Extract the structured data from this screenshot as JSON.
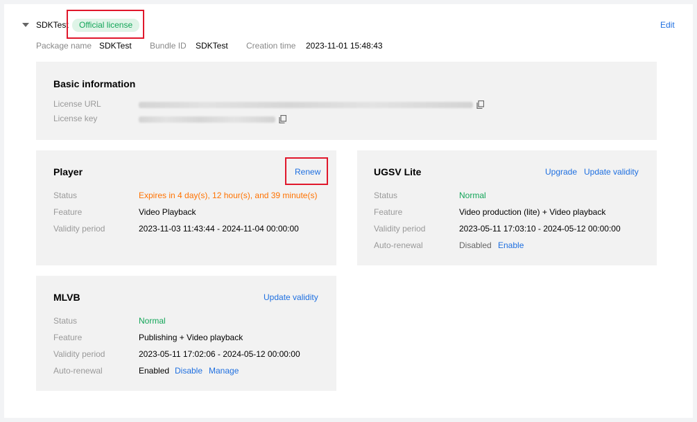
{
  "header": {
    "app_name": "SDKTest",
    "license_tag": "Official license",
    "edit_label": "Edit",
    "meta": [
      {
        "label": "Package name",
        "value": "SDKTest"
      },
      {
        "label": "Bundle ID",
        "value": "SDKTest"
      },
      {
        "label": "Creation time",
        "value": "2023-11-01 15:48:43"
      }
    ]
  },
  "basic": {
    "title": "Basic information",
    "license_url_label": "License URL",
    "license_key_label": "License key"
  },
  "player": {
    "title": "Player",
    "renew_label": "Renew",
    "rows": [
      {
        "label": "Status",
        "value": "Expires in 4 day(s), 12 hour(s), and 39 minute(s)"
      },
      {
        "label": "Feature",
        "value": "Video Playback"
      },
      {
        "label": "Validity period",
        "value": "2023-11-03 11:43:44 - 2024-11-04 00:00:00"
      }
    ]
  },
  "ugsv": {
    "title": "UGSV Lite",
    "upgrade_label": "Upgrade",
    "update_label": "Update validity",
    "rows": [
      {
        "label": "Status",
        "value": "Normal"
      },
      {
        "label": "Feature",
        "value": "Video production (lite) + Video playback"
      },
      {
        "label": "Validity period",
        "value": "2023-05-11 17:03:10 - 2024-05-12 00:00:00"
      },
      {
        "label": "Auto-renewal",
        "value": "Disabled",
        "action": "Enable"
      }
    ]
  },
  "mlvb": {
    "title": "MLVB",
    "update_label": "Update validity",
    "rows": [
      {
        "label": "Status",
        "value": "Normal"
      },
      {
        "label": "Feature",
        "value": "Publishing + Video playback"
      },
      {
        "label": "Validity period",
        "value": "2023-05-11 17:02:06 - 2024-05-12 00:00:00"
      },
      {
        "label": "Auto-renewal",
        "value": "Enabled",
        "actions": [
          "Disable",
          "Manage"
        ]
      }
    ]
  },
  "colors": {
    "link": "#1e6fe0",
    "warning": "#ff7200",
    "success": "#12a558",
    "highlight_box": "#e0172b"
  },
  "icons": [
    "caret-down-icon",
    "copy-icon"
  ]
}
